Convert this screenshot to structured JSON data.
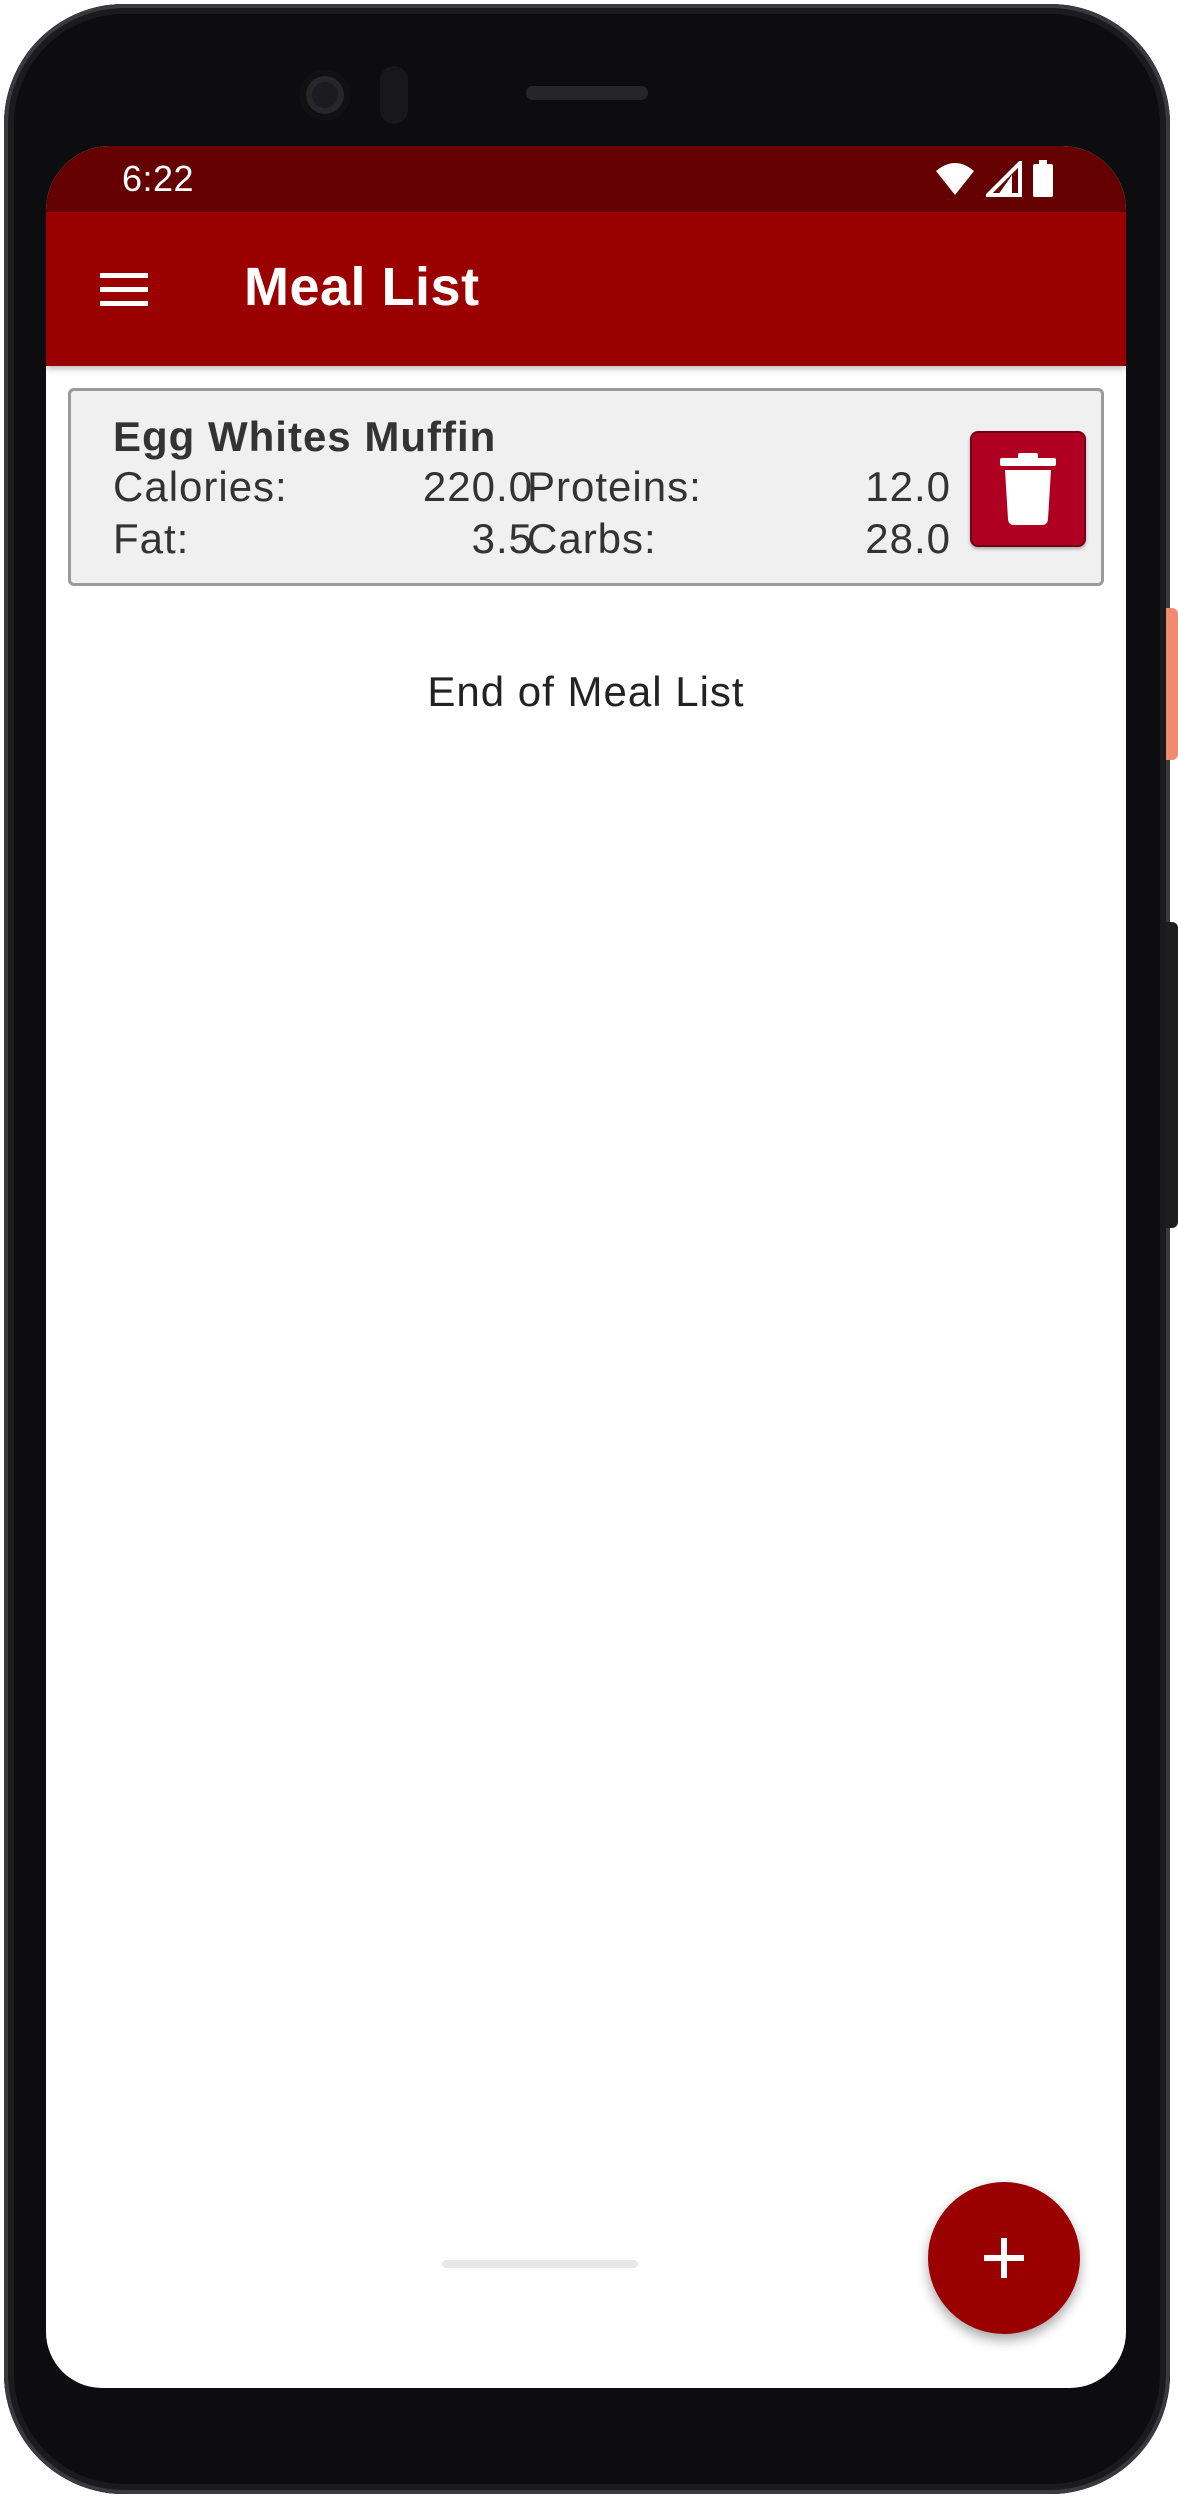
{
  "status_bar": {
    "time": "6:22",
    "icons": [
      "wifi-icon",
      "cellular-signal-icon",
      "battery-icon"
    ],
    "color": "#650000"
  },
  "app_bar": {
    "title": "Meal List",
    "menu_icon": "hamburger-menu-icon",
    "color": "#9b0000"
  },
  "meals": [
    {
      "name": "Egg Whites Muffin",
      "calories_label": "Calories:",
      "calories": "220.0",
      "proteins_label": "Proteins:",
      "proteins": "12.0",
      "fat_label": "Fat:",
      "fat": "3.5",
      "carbs_label": "Carbs:",
      "carbs": "28.0",
      "delete_icon": "trash-icon",
      "delete_color": "#b00022"
    }
  ],
  "end_of_list": "End of Meal List",
  "fab": {
    "icon": "plus-icon",
    "color": "#9b0000"
  }
}
